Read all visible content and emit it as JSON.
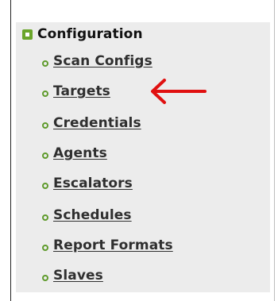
{
  "menu": {
    "section_title": "Configuration",
    "items": [
      {
        "label": "Scan Configs"
      },
      {
        "label": "Targets"
      },
      {
        "label": "Credentials"
      },
      {
        "label": "Agents"
      },
      {
        "label": "Escalators"
      },
      {
        "label": "Schedules"
      },
      {
        "label": "Report Formats"
      },
      {
        "label": "Slaves"
      }
    ],
    "highlighted_item": "Targets"
  },
  "colors": {
    "accent_green": "#6aa52a",
    "arrow_red": "#e01010",
    "panel_bg": "#ececec"
  }
}
